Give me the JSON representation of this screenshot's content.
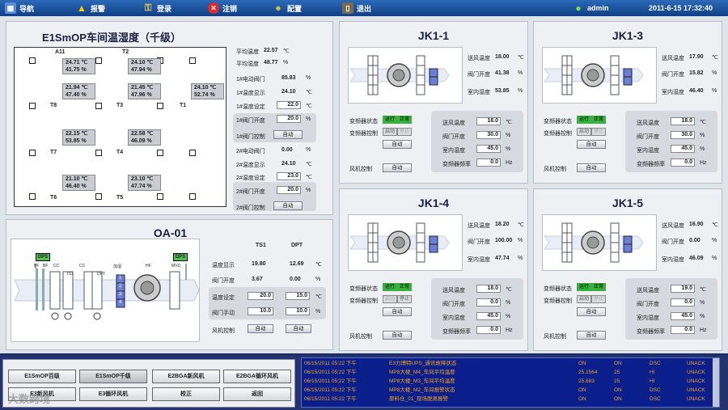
{
  "topbar": {
    "nav": "导航",
    "alarm": "报警",
    "login": "登录",
    "logout": "注销",
    "config": "配置",
    "exit": "退出",
    "user": "admin",
    "datetime": "2011-6-15  17:32:40"
  },
  "zone": {
    "title": "E1SmOP车间温湿度（千级）",
    "sensors": [
      {
        "tag": "A11",
        "t": "24.71 ℃",
        "h": "41.75 %"
      },
      {
        "tag": "T2",
        "t": "24.10 ℃",
        "h": "47.94 %"
      },
      {
        "tag": "",
        "t": "21.94 ℃",
        "h": "47.40 %"
      },
      {
        "tag": "",
        "t": "21.45 ℃",
        "h": "47.96 %"
      },
      {
        "tag": "",
        "t": "24.10 ℃",
        "h": "52.74 %"
      },
      {
        "tag": "",
        "t": "22.15 ℃",
        "h": "53.85 %"
      },
      {
        "tag": "",
        "t": "22.58 ℃",
        "h": "46.09 %"
      },
      {
        "tag": "",
        "t": "21.10 ℃",
        "h": "46.40 %"
      },
      {
        "tag": "",
        "t": "23.10 ℃",
        "h": "47.74 %"
      }
    ],
    "tags": [
      "T8",
      "T3",
      "T1",
      "T7",
      "T4",
      "T6",
      "T5"
    ],
    "avg_temp_label": "平均温度",
    "avg_temp": "22.57",
    "avg_temp_unit": "℃",
    "avg_hum_label": "平均湿度",
    "avg_hum": "48.77",
    "avg_hum_unit": "%",
    "rows": [
      {
        "label": "1#电动阀门",
        "value": "85.83",
        "unit": "%"
      },
      {
        "label": "1#温度显示",
        "value": "24.10",
        "unit": "℃"
      },
      {
        "label": "1#温度设定",
        "input": "22.0",
        "unit": "℃"
      },
      {
        "label": "1#阀门开度",
        "input": "20.0",
        "unit": "%"
      },
      {
        "label": "1#阀门控制",
        "button": "自动"
      },
      {
        "label": "2#电动阀门",
        "value": "0.00",
        "unit": "%"
      },
      {
        "label": "2#温度显示",
        "value": "24.10",
        "unit": "℃"
      },
      {
        "label": "2#温度设定",
        "input": "23.0",
        "unit": "℃"
      },
      {
        "label": "2#阀门开度",
        "input": "20.0",
        "unit": "%"
      },
      {
        "label": "2#阀门控制",
        "button": "自动"
      }
    ]
  },
  "oa": {
    "title": "OA-01",
    "col1": "TS1",
    "col2": "DPT",
    "dps1": "DPS",
    "dps2": "DPS",
    "diagram_labels": {
      "pf": "PF",
      "bf": "BF",
      "cc1": "CC",
      "cc2": "CC",
      "ts1": "TS1",
      "dpt": "DPT",
      "heat": "加湿",
      "hf": "HF",
      "mvd": "MVD"
    },
    "steps": [
      "1",
      "2",
      "3",
      "4"
    ],
    "rows": [
      {
        "label": "温度显示",
        "v1": "19.80",
        "v2": "12.69",
        "unit": "℃"
      },
      {
        "label": "阀门开度",
        "v1": "3.67",
        "v2": "0.00",
        "unit": "%"
      },
      {
        "label": "温度设定",
        "i1": "20.0",
        "i2": "15.0",
        "unit": "℃"
      },
      {
        "label": "阀门手动",
        "i1": "10.0",
        "i2": "10.0",
        "unit": "%"
      }
    ],
    "fan_label": "风机控制",
    "fan_btn1": "自动",
    "fan_btn2": "自动"
  },
  "ahus": [
    {
      "title": "JK1-1",
      "supply": "18.00",
      "valve": "41.38",
      "room": "53.85",
      "run": "运行",
      "normal": "正常",
      "start": "启动",
      "stop": "停止",
      "stop_disabled": true,
      "start_disabled": false,
      "freq_btn": "自动",
      "fan_btn": "自动",
      "sp_temp": "18.0",
      "sp_valve": "30.0",
      "sp_hum": "45.0",
      "sp_freq": "0.0"
    },
    {
      "title": "JK1-3",
      "supply": "17.90",
      "valve": "15.82",
      "room": "46.40",
      "run": "运行",
      "normal": "正常",
      "start": "启动",
      "stop": "停止",
      "stop_disabled": true,
      "start_disabled": false,
      "freq_btn": "自动",
      "fan_btn": "自动",
      "sp_temp": "18.0",
      "sp_valve": "30.0",
      "sp_hum": "45.0",
      "sp_freq": "0.0"
    },
    {
      "title": "JK1-4",
      "supply": "18.20",
      "valve": "100.00",
      "room": "47.74",
      "run": "运行",
      "normal": "正常",
      "start": "启动",
      "stop": "停止",
      "stop_disabled": false,
      "start_disabled": true,
      "freq_btn": "自动",
      "fan_btn": "自动",
      "sp_temp": "18.0",
      "sp_valve": "0.0",
      "sp_hum": "45.0",
      "sp_freq": "0.0"
    },
    {
      "title": "JK1-5",
      "supply": "16.90",
      "valve": "0.00",
      "room": "46.09",
      "run": "运行",
      "normal": "正常",
      "start": "启动",
      "stop": "停止",
      "stop_disabled": true,
      "start_disabled": false,
      "freq_btn": "自动",
      "fan_btn": "自动",
      "sp_temp": "19.0",
      "sp_valve": "0.0",
      "sp_hum": "45.0",
      "sp_freq": "0.0"
    }
  ],
  "ahu_labels": {
    "supply_label": "送风温度",
    "supply_unit": "℃",
    "valve_label": "阀门开度",
    "valve_unit": "%",
    "room_label": "室内湿度",
    "room_unit": "%",
    "vfd_status": "变频器状态",
    "vfd_ctrl": "变频器控制",
    "fan_ctrl": "风机控制",
    "sp_temp_label": "送风温度",
    "sp_valve_label": "阀门开度",
    "sp_hum_label": "室内湿度",
    "sp_freq_label": "变频器频率",
    "sp_temp_unit": "℃",
    "sp_valve_unit": "%",
    "sp_hum_unit": "%",
    "sp_freq_unit": "Hz"
  },
  "nav": {
    "b1": "E1SmOP百级",
    "b2": "E1SmOP千级",
    "b3": "E2BGA新风机",
    "b4": "E2BGA循环风机",
    "b5": "E3新风机",
    "b6": "E3循环风机",
    "b7": "校正",
    "b8": "返回"
  },
  "watermark": "大数跨境",
  "alarms": [
    {
      "time": "06/15/2011 05:22 下午",
      "msg": "E3力博特UPS_通讯故障状态",
      "state": "ON",
      "value": "ON",
      "type": "DSC",
      "ack": "UNACK"
    },
    {
      "time": "06/15/2011 05:22 下午",
      "msg": "MP8大楼_M4_车间平均温度",
      "state": "25.1564",
      "value": "25",
      "type": "HI",
      "ack": "UNACK"
    },
    {
      "time": "06/15/2011 05:22 下午",
      "msg": "MP8大楼_M3_车间平均温度",
      "state": "25.683",
      "value": "25",
      "type": "HI",
      "ack": "UNACK"
    },
    {
      "time": "06/15/2011 05:22 下午",
      "msg": "MP8大楼_M2_车间报警状态",
      "state": "ON",
      "value": "ON",
      "type": "DSC",
      "ack": "UNACK"
    },
    {
      "time": "06/15/2011 05:22 下午",
      "msg": "原料仓_01_现场脱离报警",
      "state": "ON",
      "value": "ON",
      "type": "DSC",
      "ack": "UNACK"
    }
  ]
}
